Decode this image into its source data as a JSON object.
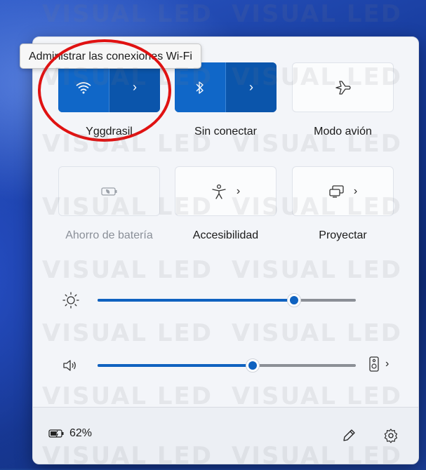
{
  "tooltip": "Administrar las conexiones Wi-Fi",
  "tiles": {
    "wifi": {
      "label": "Yggdrasil",
      "state": "on"
    },
    "bluetooth": {
      "label": "Sin conectar",
      "state": "on"
    },
    "airplane": {
      "label": "Modo avión",
      "state": "off"
    },
    "battery_saver": {
      "label": "Ahorro de batería",
      "state": "disabled"
    },
    "accessibility": {
      "label": "Accesibilidad",
      "state": "off"
    },
    "project": {
      "label": "Proyectar",
      "state": "off"
    }
  },
  "sliders": {
    "brightness": {
      "value": 0.76
    },
    "volume": {
      "value": 0.6
    }
  },
  "footer": {
    "battery_percent": "62%"
  },
  "icons": {
    "wifi": "wifi-icon",
    "bluetooth": "bluetooth-icon",
    "airplane": "airplane-icon",
    "battery_saver": "battery-saver-icon",
    "accessibility": "accessibility-icon",
    "project": "project-icon",
    "brightness": "brightness-icon",
    "volume": "volume-icon",
    "audio_output": "speaker-device-icon",
    "edit": "pencil-icon",
    "settings": "gear-icon"
  },
  "colors": {
    "accent": "#0f62c0",
    "highlight_circle": "#e01212"
  },
  "watermark": "VISUAL LED"
}
